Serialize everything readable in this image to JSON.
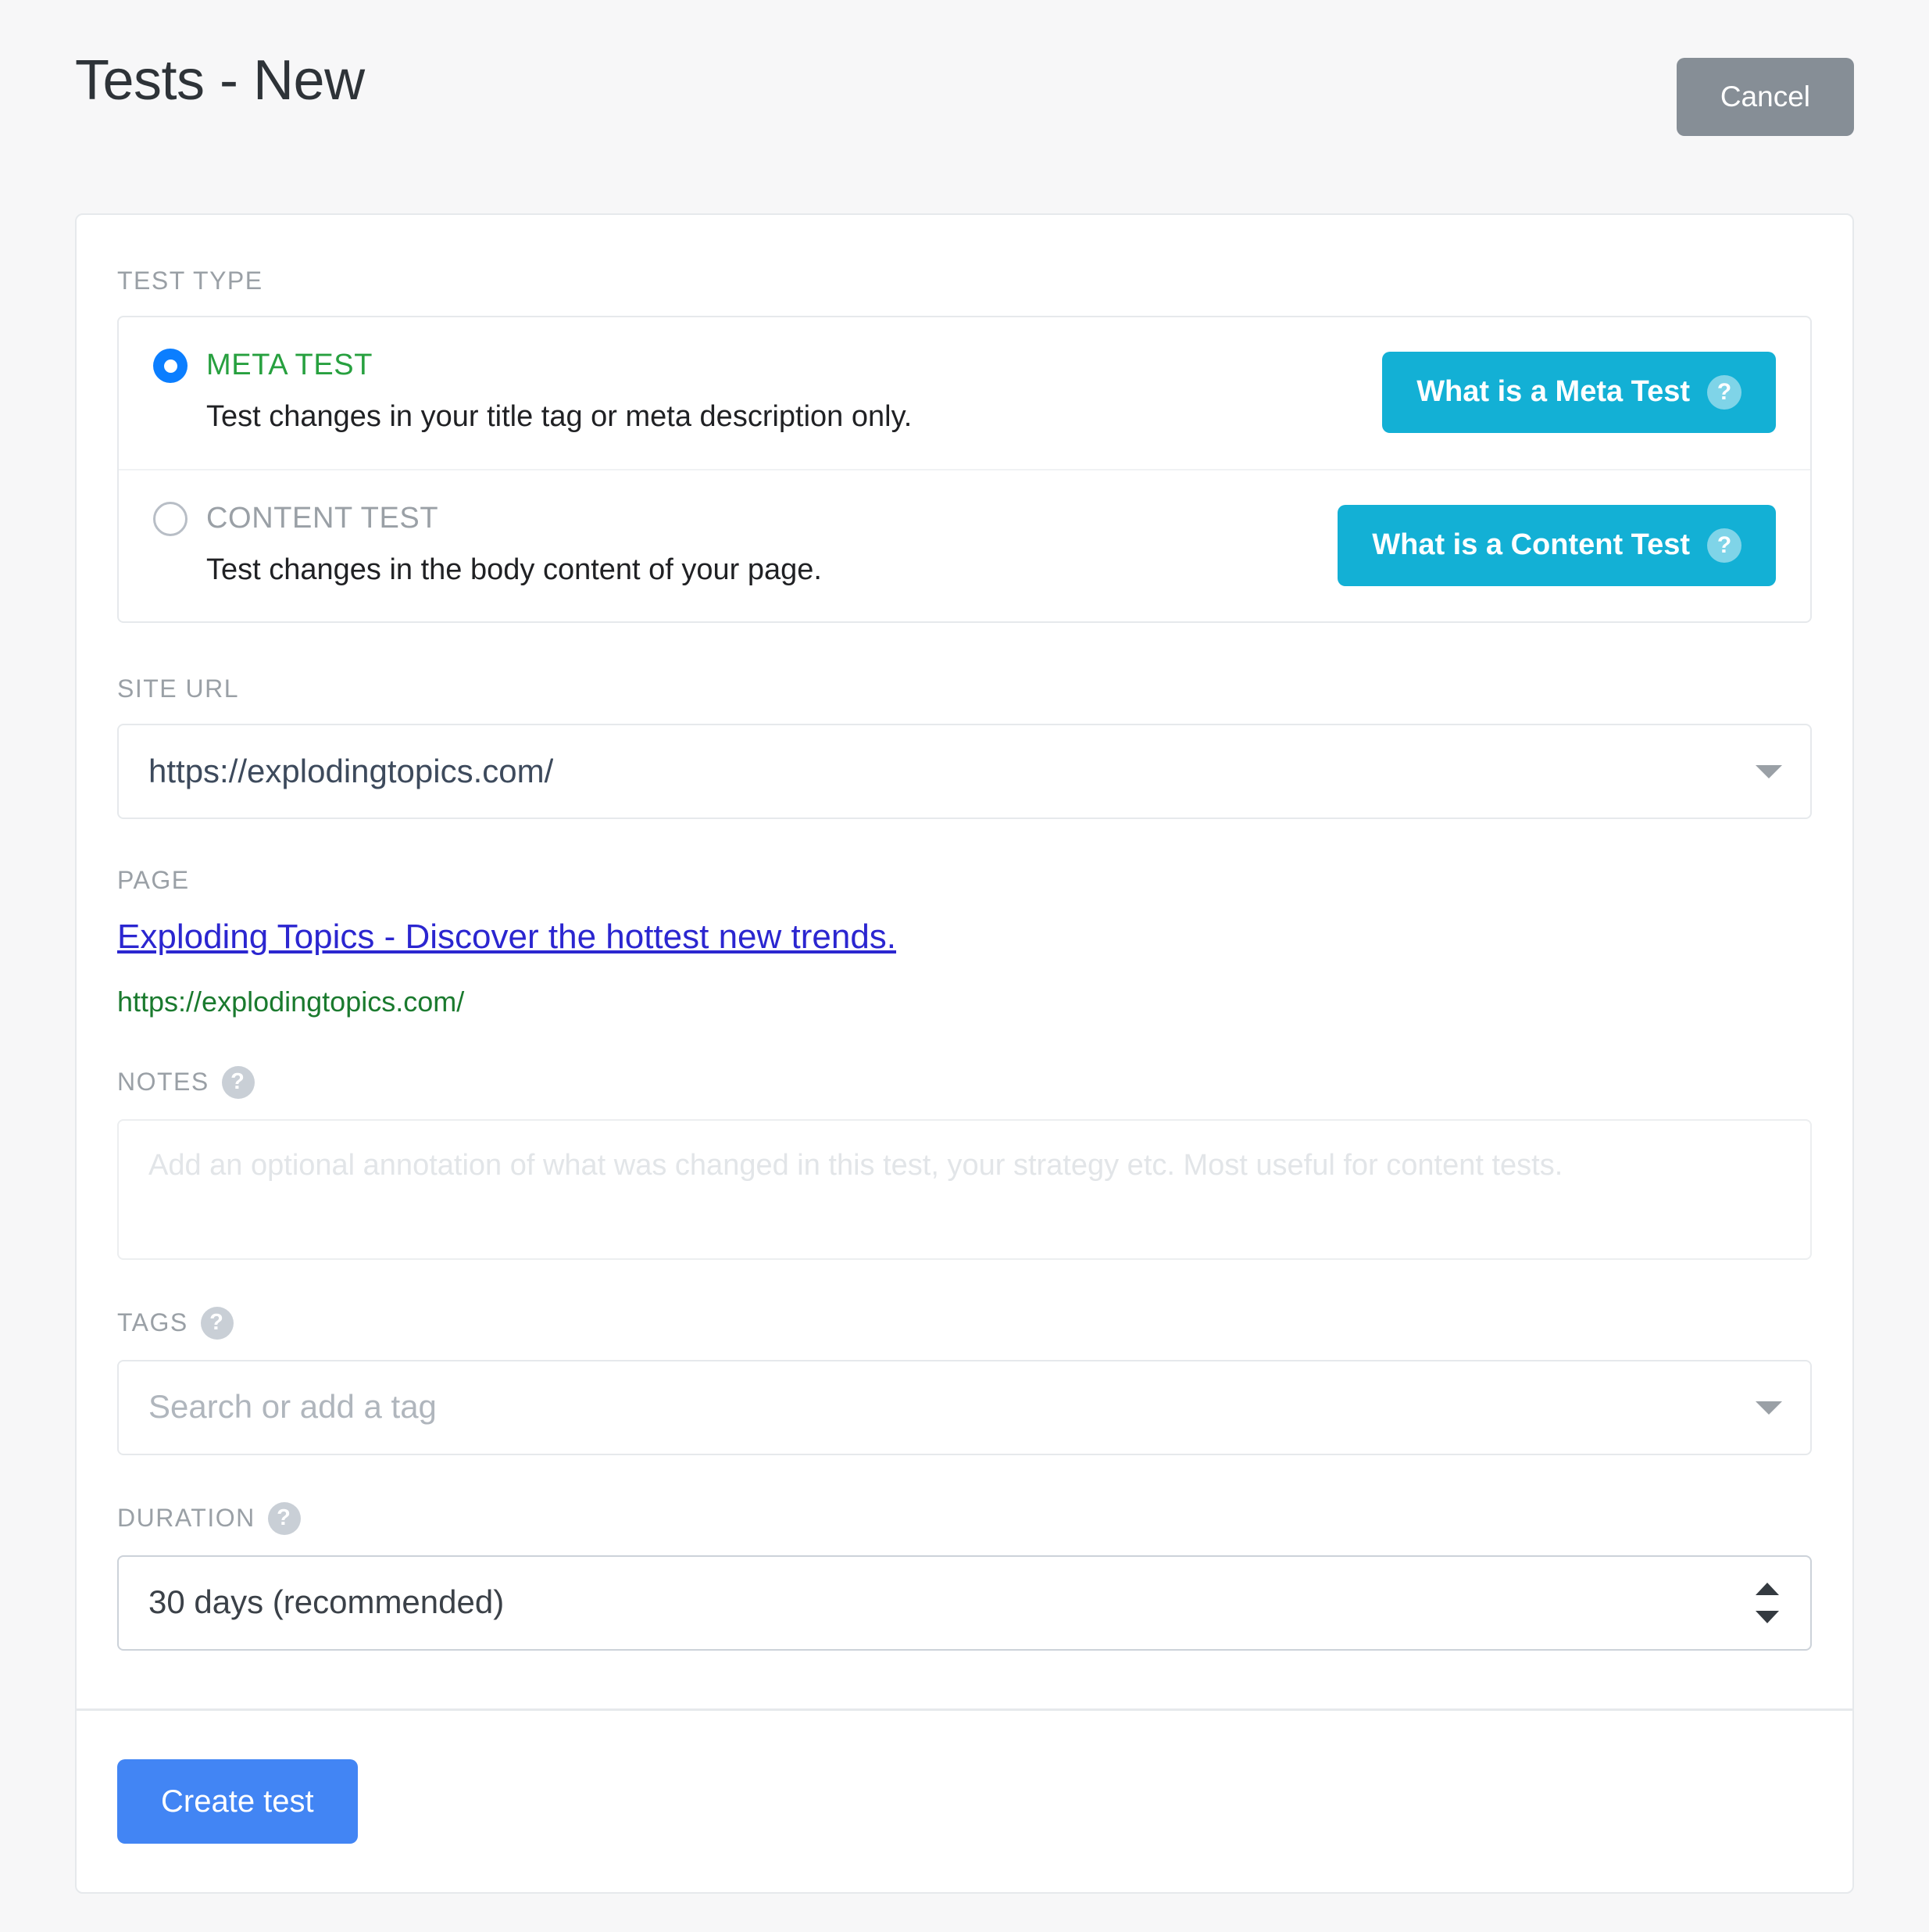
{
  "header": {
    "title": "Tests - New",
    "cancel_label": "Cancel"
  },
  "form": {
    "test_type": {
      "label": "TEST TYPE",
      "options": [
        {
          "title": "META TEST",
          "description": "Test changes in your title tag or meta description only.",
          "selected": true,
          "info_button": "What is a Meta Test",
          "info_icon": "question-mark-icon"
        },
        {
          "title": "CONTENT TEST",
          "description": "Test changes in the body content of your page.",
          "selected": false,
          "info_button": "What is a Content Test",
          "info_icon": "question-mark-icon"
        }
      ]
    },
    "site_url": {
      "label": "SITE URL",
      "value": "https://explodingtopics.com/",
      "dropdown_icon": "chevron-down-icon"
    },
    "page": {
      "label": "PAGE",
      "result_title": "Exploding Topics - Discover the hottest new trends.",
      "result_url": "https://explodingtopics.com/"
    },
    "notes": {
      "label": "NOTES",
      "help_icon": "question-mark-icon",
      "value": "",
      "placeholder": "Add an optional annotation of what was changed in this test, your strategy etc. Most useful for content tests."
    },
    "tags": {
      "label": "TAGS",
      "help_icon": "question-mark-icon",
      "value": "",
      "placeholder": "Search or add a tag",
      "dropdown_icon": "chevron-down-icon"
    },
    "duration": {
      "label": "DURATION",
      "help_icon": "question-mark-icon",
      "selected": "30 days (recommended)",
      "spinner_icon": "up-down-arrows-icon"
    },
    "submit_label": "Create test"
  },
  "colors": {
    "page_background": "#f7f7f8",
    "card_background": "#ffffff",
    "accent_cyan": "#13b0d5",
    "accent_blue": "#4285f4",
    "radio_blue": "#0b7eff",
    "meta_green": "#27a03f",
    "link_blue": "#2b26d0",
    "url_green": "#1a7a2e",
    "cancel_gray": "#868e96"
  }
}
